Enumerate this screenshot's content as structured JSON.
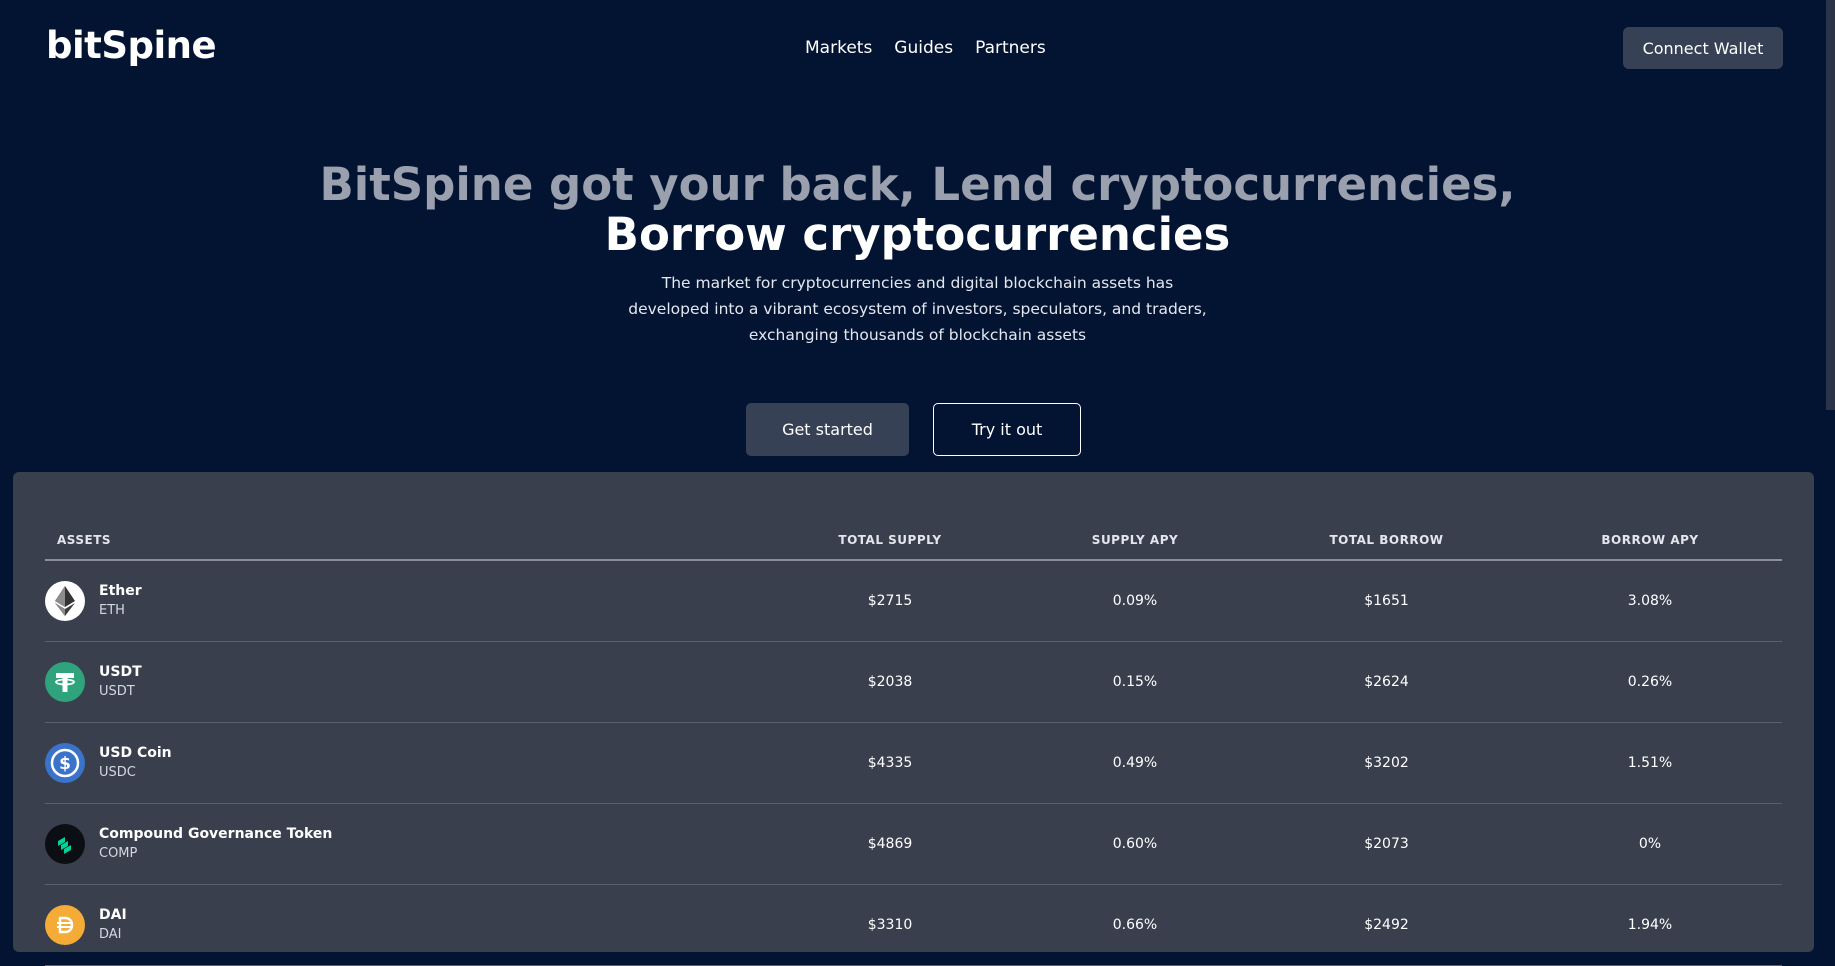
{
  "brand": {
    "logo": "bitSpine"
  },
  "nav": {
    "links": [
      "Markets",
      "Guides",
      "Partners"
    ],
    "connect_wallet": "Connect Wallet"
  },
  "hero": {
    "line1": "BitSpine got your back, Lend cryptocurrencies,",
    "line2": "Borrow cryptocurrencies",
    "description": "The market for cryptocurrencies and digital blockchain assets has developed into a vibrant ecosystem of investors, speculators, and traders, exchanging thousands of blockchain assets",
    "get_started": "Get started",
    "try_it_out": "Try it out"
  },
  "table": {
    "headers": {
      "assets": "ASSETS",
      "total_supply": "TOTAL SUPPLY",
      "supply_apy": "SUPPLY APY",
      "total_borrow": "TOTAL BORROW",
      "borrow_apy": "BORROW APY"
    },
    "rows": [
      {
        "name": "Ether",
        "symbol": "ETH",
        "icon": "ether-icon",
        "color": "#ffffff",
        "total_supply": "$2715",
        "supply_apy": "0.09%",
        "total_borrow": "$1651",
        "borrow_apy": "3.08%"
      },
      {
        "name": "USDT",
        "symbol": "USDT",
        "icon": "tether-icon",
        "color": "#2fa37c",
        "total_supply": "$2038",
        "supply_apy": "0.15%",
        "total_borrow": "$2624",
        "borrow_apy": "0.26%"
      },
      {
        "name": "USD Coin",
        "symbol": "USDC",
        "icon": "usdc-icon",
        "color": "#3a73c9",
        "total_supply": "$4335",
        "supply_apy": "0.49%",
        "total_borrow": "$3202",
        "borrow_apy": "1.51%"
      },
      {
        "name": "Compound Governance Token",
        "symbol": "COMP",
        "icon": "compound-icon",
        "color": "#0b0f14",
        "total_supply": "$4869",
        "supply_apy": "0.60%",
        "total_borrow": "$2073",
        "borrow_apy": "0%"
      },
      {
        "name": "DAI",
        "symbol": "DAI",
        "icon": "dai-icon",
        "color": "#f5ac37",
        "total_supply": "$3310",
        "supply_apy": "0.66%",
        "total_borrow": "$2492",
        "borrow_apy": "1.94%"
      }
    ]
  },
  "colors": {
    "background": "#031433",
    "panel": "#3a3f4e",
    "button": "#364156"
  }
}
